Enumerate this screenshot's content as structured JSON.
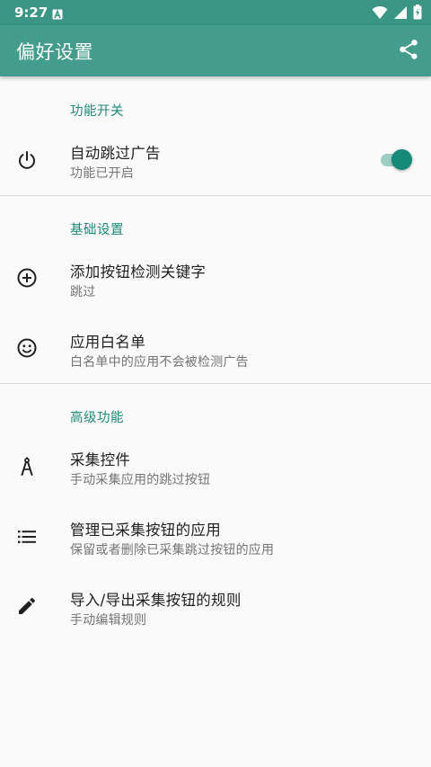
{
  "status_bar": {
    "time": "9:27",
    "notification_icon": "notification-a-icon",
    "icons": [
      "wifi-icon",
      "signal-icon",
      "battery-icon"
    ]
  },
  "app_bar": {
    "title": "偏好设置",
    "action_icon": "share-icon",
    "color": "#449d8c"
  },
  "sections": [
    {
      "header": "功能开关",
      "items": [
        {
          "icon": "power-icon",
          "title": "自动跳过广告",
          "subtitle": "功能已开启",
          "toggle_on": true
        }
      ]
    },
    {
      "header": "基础设置",
      "items": [
        {
          "icon": "add-circle-icon",
          "title": "添加按钮检测关键字",
          "subtitle": "跳过"
        },
        {
          "icon": "smiley-icon",
          "title": "应用白名单",
          "subtitle": "白名单中的应用不会被检测广告"
        }
      ]
    },
    {
      "header": "高级功能",
      "items": [
        {
          "icon": "compass-icon",
          "title": "采集控件",
          "subtitle": "手动采集应用的跳过按钮"
        },
        {
          "icon": "list-icon",
          "title": "管理已采集按钮的应用",
          "subtitle": "保留或者删除已采集跳过按钮的应用"
        },
        {
          "icon": "edit-pencil-icon",
          "title": "导入/导出采集按钮的规则",
          "subtitle": "手动编辑规则"
        }
      ]
    }
  ],
  "accent_color": "#1e8a7a"
}
